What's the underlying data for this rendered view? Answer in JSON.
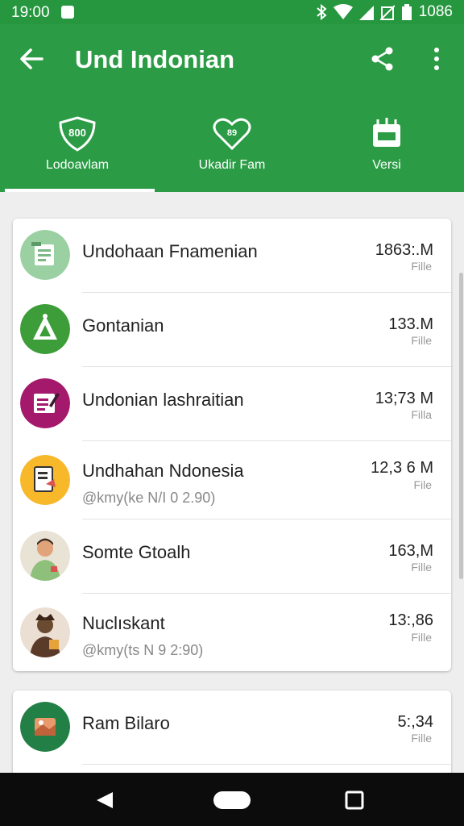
{
  "status_bar": {
    "time": "19:00",
    "battery": "1086"
  },
  "app_bar": {
    "title": "Und Indonian"
  },
  "tabs": [
    {
      "label": "Lodoavlam",
      "icon": "shield-icon",
      "badge": "800"
    },
    {
      "label": "Ukadir Fam",
      "icon": "heart-icon",
      "badge": "89"
    },
    {
      "label": "Versi",
      "icon": "folder-icon"
    }
  ],
  "list": [
    {
      "name": "Undohaan Fnamenian",
      "size": "1863:.M",
      "unit": "Fille",
      "icon": "document-icon",
      "color": "#9bd0a2"
    },
    {
      "name": "Gontanian",
      "size": "133.M",
      "unit": "Fille",
      "icon": "tent-icon",
      "color": "#3d9d38"
    },
    {
      "name": "Undonian lashraitian",
      "size": "13;73 M",
      "unit": "Filla",
      "icon": "edit-doc-icon",
      "color": "#a5196c"
    },
    {
      "name": "Undhahan Ndonesia",
      "sub": "@kmy(ke N/I 0 2.90)",
      "size": "12,3 6 M",
      "unit": "File",
      "icon": "file-icon",
      "color": "#f7b82a"
    },
    {
      "name": "Somte Gtoalh",
      "size": "163,M",
      "unit": "Fille",
      "icon": "person-avatar",
      "color": "#e9e3d6"
    },
    {
      "name": "Nuclıskant",
      "sub": "@kmy(ts N 9 2:90)",
      "size": "13:,86",
      "unit": "Fille",
      "icon": "person-avatar",
      "color": "#eadfd2"
    },
    {
      "name": "Ram Bilaro",
      "size": "5:,34",
      "unit": "Fille",
      "icon": "image-icon",
      "color": "#227f45"
    }
  ]
}
